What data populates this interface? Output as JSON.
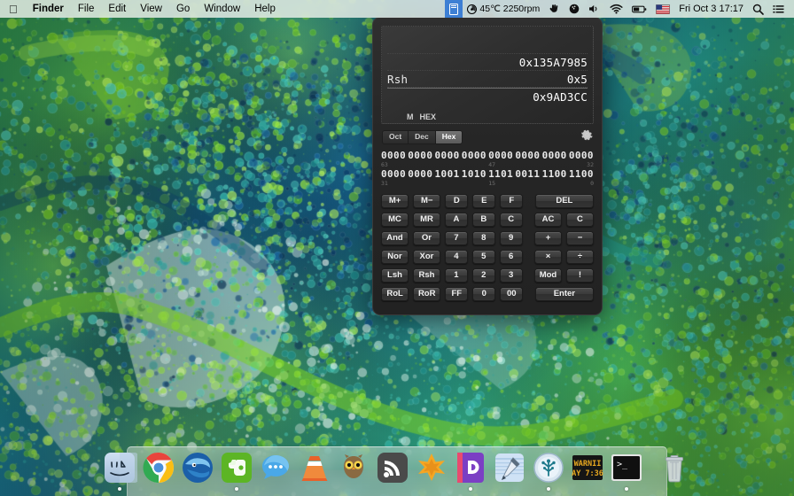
{
  "menubar": {
    "apple_icon": "apple-logo-icon",
    "items": [
      {
        "label": "Finder",
        "bold": true
      },
      {
        "label": "File",
        "bold": false
      },
      {
        "label": "Edit",
        "bold": false
      },
      {
        "label": "View",
        "bold": false
      },
      {
        "label": "Go",
        "bold": false
      },
      {
        "label": "Window",
        "bold": false
      },
      {
        "label": "Help",
        "bold": false
      }
    ],
    "status": {
      "fan_temp": "45℃ 2250rpm",
      "fan_icon": "fan-temp-icon",
      "hand_icon": "hand-icon",
      "bowling_icon": "bowling-ball-icon",
      "volume_icon": "volume-icon",
      "wifi_icon": "wifi-icon",
      "battery_icon": "battery-icon",
      "input_source_icon": "us-flag-icon",
      "datetime": "Fri Oct 3  17:17",
      "search_icon": "search-icon",
      "notification_icon": "notification-center-icon",
      "calculator_icon": "calculator-menu-icon"
    }
  },
  "calculator": {
    "display": {
      "operand": "0x135A7985",
      "operation_label": "Rsh",
      "operation_value": "0x5",
      "result": "0x9AD3CC",
      "flags": [
        "M",
        "HEX"
      ]
    },
    "base_tabs": [
      {
        "label": "Oct",
        "selected": false
      },
      {
        "label": "Dec",
        "selected": false
      },
      {
        "label": "Hex",
        "selected": true
      }
    ],
    "settings_icon": "gear-icon",
    "binary": {
      "high": {
        "groups": [
          "0000",
          "0000",
          "0000",
          "0000",
          "0000",
          "0000",
          "0000",
          "0000"
        ],
        "label_left": "63",
        "label_mid": "47",
        "label_right": "32"
      },
      "low": {
        "groups": [
          "0000",
          "0000",
          "1001",
          "1010",
          "1101",
          "0011",
          "1100",
          "1100"
        ],
        "label_left": "31",
        "label_mid": "15",
        "label_right": "0"
      }
    },
    "keys": [
      [
        {
          "label": "M+",
          "type": "fn"
        },
        {
          "label": "M−",
          "type": "fn"
        },
        {
          "label": "D",
          "type": "dig"
        },
        {
          "label": "E",
          "type": "dig"
        },
        {
          "label": "F",
          "type": "dig"
        },
        {
          "label": "DEL",
          "type": "wide"
        }
      ],
      [
        {
          "label": "MC",
          "type": "fn"
        },
        {
          "label": "MR",
          "type": "fn"
        },
        {
          "label": "A",
          "type": "dig"
        },
        {
          "label": "B",
          "type": "dig"
        },
        {
          "label": "C",
          "type": "dig"
        },
        {
          "label": "AC",
          "type": "op"
        },
        {
          "label": "C",
          "type": "op"
        }
      ],
      [
        {
          "label": "And",
          "type": "fn"
        },
        {
          "label": "Or",
          "type": "fn"
        },
        {
          "label": "7",
          "type": "dig"
        },
        {
          "label": "8",
          "type": "dig"
        },
        {
          "label": "9",
          "type": "dig"
        },
        {
          "label": "+",
          "type": "op"
        },
        {
          "label": "−",
          "type": "op"
        }
      ],
      [
        {
          "label": "Nor",
          "type": "fn"
        },
        {
          "label": "Xor",
          "type": "fn"
        },
        {
          "label": "4",
          "type": "dig"
        },
        {
          "label": "5",
          "type": "dig"
        },
        {
          "label": "6",
          "type": "dig"
        },
        {
          "label": "×",
          "type": "op"
        },
        {
          "label": "÷",
          "type": "op"
        }
      ],
      [
        {
          "label": "Lsh",
          "type": "fn"
        },
        {
          "label": "Rsh",
          "type": "fn"
        },
        {
          "label": "1",
          "type": "dig"
        },
        {
          "label": "2",
          "type": "dig"
        },
        {
          "label": "3",
          "type": "dig"
        },
        {
          "label": "Mod",
          "type": "op"
        },
        {
          "label": "!",
          "type": "op"
        }
      ],
      [
        {
          "label": "RoL",
          "type": "fn"
        },
        {
          "label": "RoR",
          "type": "fn"
        },
        {
          "label": "FF",
          "type": "dig"
        },
        {
          "label": "0",
          "type": "dig"
        },
        {
          "label": "00",
          "type": "dig"
        },
        {
          "label": "Enter",
          "type": "wide"
        }
      ]
    ]
  },
  "dock": {
    "items": [
      {
        "name": "finder",
        "label": "Finder",
        "running": true
      },
      {
        "name": "chrome",
        "label": "Google Chrome",
        "running": false
      },
      {
        "name": "thunderbird",
        "label": "Thunderbird",
        "running": false
      },
      {
        "name": "evernote",
        "label": "Evernote",
        "running": true
      },
      {
        "name": "messages",
        "label": "Messages",
        "running": false
      },
      {
        "name": "vlc",
        "label": "VLC",
        "running": false
      },
      {
        "name": "owl-app",
        "label": "Tweetbot",
        "running": false
      },
      {
        "name": "rss-reader",
        "label": "Reeder",
        "running": false
      },
      {
        "name": "wolfram",
        "label": "Mathematica",
        "running": false
      },
      {
        "name": "dash",
        "label": "Dash",
        "running": true
      },
      {
        "name": "xcode",
        "label": "Xcode",
        "running": false
      },
      {
        "name": "brain-app",
        "label": "DEVONthink",
        "running": true
      },
      {
        "name": "warning-sign",
        "label": "WARNING",
        "running": false
      },
      {
        "name": "terminal",
        "label": "Terminal",
        "running": true
      },
      {
        "name": "trash",
        "label": "Trash",
        "running": false
      }
    ],
    "warning_sign_text_1": "WARNII",
    "warning_sign_text_2": "AY 7:36"
  },
  "colors": {
    "menubar_bg": "#ebf0eb",
    "calc_bg": "#272727",
    "accent_blue": "#3d7fd4",
    "wallpaper_green": "#7ed321",
    "wallpaper_teal": "#2ba3a0",
    "wallpaper_navy": "#0d3b66"
  }
}
